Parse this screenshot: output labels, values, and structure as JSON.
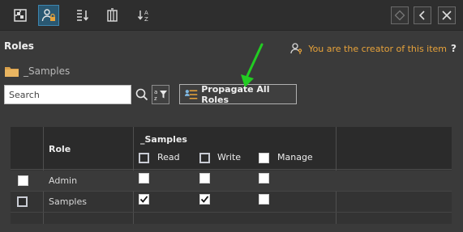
{
  "toolbar": {
    "icons": [
      "puzzle-icon",
      "user-lock-icon",
      "list-sort-icon",
      "table-lock-icon",
      "sort-az-icon"
    ],
    "right": [
      "diamond-icon",
      "chevron-left-icon",
      "close-icon"
    ]
  },
  "panel": {
    "title": "Roles",
    "creator_text": "You are the creator of this item",
    "help": "?"
  },
  "folder": {
    "name": "_Samples"
  },
  "search": {
    "placeholder": "Search"
  },
  "propagate": {
    "label": "Propagate All Roles"
  },
  "grid": {
    "role_header": "Role",
    "group_header": "_Samples",
    "perm_headers": [
      "Read",
      "Write",
      "Manage"
    ],
    "rows": [
      {
        "name": "Admin",
        "selected": false,
        "read": false,
        "write": false,
        "manage": false
      },
      {
        "name": "Samples",
        "selected": false,
        "read": true,
        "write": true,
        "manage": false
      }
    ]
  },
  "colors": {
    "accent": "#e8a33a",
    "arrow": "#22cc22",
    "active_tab": "#2a5872"
  }
}
